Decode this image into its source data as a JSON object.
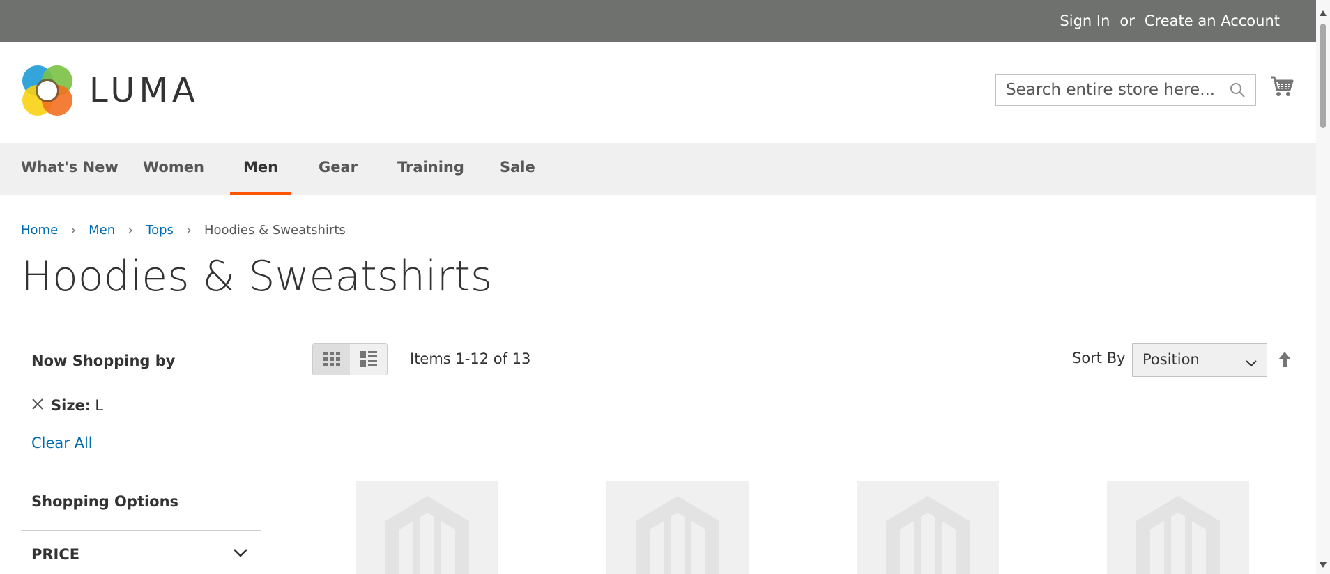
{
  "topbar": {
    "sign_in": "Sign In",
    "or": "or",
    "create_account": "Create an Account"
  },
  "header": {
    "logo_text": "LUMA",
    "search_placeholder": "Search entire store here...",
    "cart_icon": "cart-icon",
    "search_icon": "search-icon"
  },
  "nav": {
    "items": [
      {
        "label": "What's New"
      },
      {
        "label": "Women"
      },
      {
        "label": "Men",
        "active": true
      },
      {
        "label": "Gear"
      },
      {
        "label": "Training"
      },
      {
        "label": "Sale"
      }
    ]
  },
  "breadcrumb": {
    "items": [
      "Home",
      "Men",
      "Tops",
      "Hoodies & Sweatshirts"
    ]
  },
  "page_title": "Hoodies & Sweatshirts",
  "sidebar": {
    "now_shopping": "Now Shopping by",
    "filter_label": "Size:",
    "filter_value": "L",
    "clear_all": "Clear All",
    "shopping_options": "Shopping Options",
    "price_label": "PRICE"
  },
  "toolbar": {
    "items_text": "Items 1-12 of 13",
    "sort_label": "Sort By",
    "sort_value": "Position",
    "view_modes": [
      "grid",
      "list"
    ]
  },
  "colors": {
    "topbar": "#6e716e",
    "nav_bg": "#f0f0f0",
    "active_underline": "#ff5501",
    "link": "#006bb4",
    "text": "#333333"
  },
  "product_placeholders": 4
}
